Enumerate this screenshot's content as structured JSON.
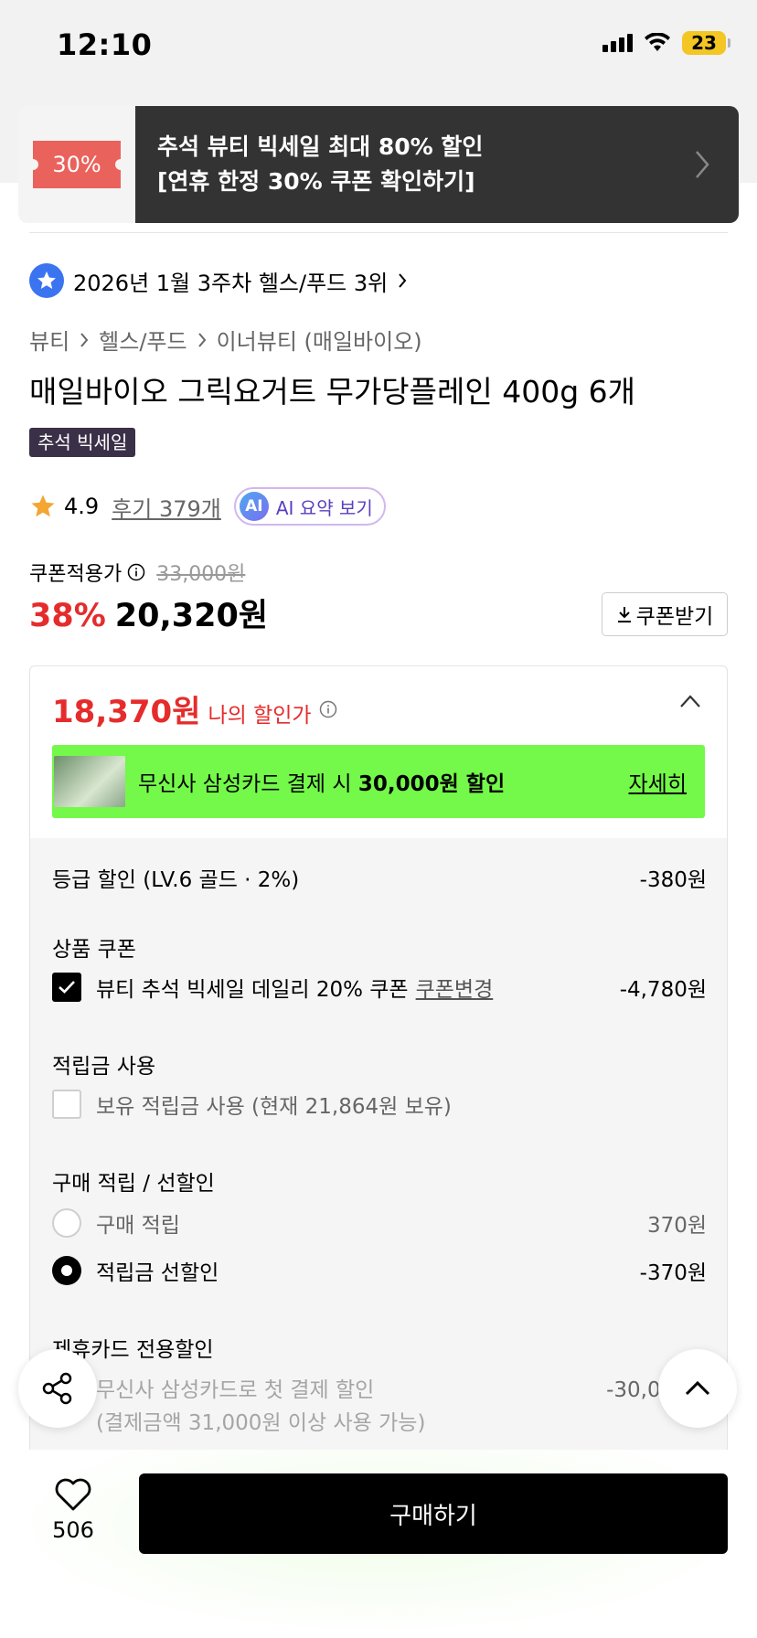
{
  "status_bar": {
    "time": "12:10",
    "battery": "23"
  },
  "banner": {
    "coupon_label": "30%",
    "line1": "추석 뷰티 빅세일 최대 80% 할인",
    "line2": "[연휴 한정 30% 쿠폰 확인하기]"
  },
  "ranking": {
    "text": "2026년 1월 3주차 헬스/푸드 3위"
  },
  "breadcrumb": [
    "뷰티",
    "헬스/푸드",
    "이너뷰티 (매일바이오)"
  ],
  "product": {
    "title": "매일바이오 그릭요거트 무가당플레인 400g 6개",
    "event_badge": "추석 빅세일",
    "rating": "4.9",
    "reviews": "후기 379개",
    "ai_summary": "AI 요약 보기",
    "ai_badge": "AI"
  },
  "pricing": {
    "coupon_price_label": "쿠폰적용가",
    "original_price": "33,000원",
    "discount_pct": "38%",
    "sale_price": "20,320원",
    "coupon_button": "쿠폰받기"
  },
  "my_price": {
    "amount": "18,370원",
    "label": "나의 할인가",
    "promo_text_1": "무신사 삼성카드 결제 시 ",
    "promo_text_bold": "30,000원 할인",
    "promo_link": "자세히"
  },
  "discounts": {
    "grade_label": "등급 할인 (LV.6 골드 · 2%)",
    "grade_amount": "-380원",
    "coupon_section": "상품 쿠폰",
    "coupon_item": "뷰티 추석 빅세일 데일리 20% 쿠폰",
    "coupon_change": "쿠폰변경",
    "coupon_amount": "-4,780원",
    "points_section": "적립금 사용",
    "points_item": "보유 적립금 사용 (현재 21,864원 보유)",
    "purchase_section": "구매 적립 / 선할인",
    "purchase_earn": "구매 적립",
    "purchase_earn_amount": "370원",
    "purchase_pre": "적립금 선할인",
    "purchase_pre_amount": "-370원",
    "card_section": "제휴카드 전용할인",
    "card_item": "무신사 삼성카드로 첫 결제 할인",
    "card_amount": "-30,000원",
    "card_note": "(결제금액 31,000원 이상 사용 가능)"
  },
  "bottom": {
    "likes": "506",
    "buy_button": "구매하기"
  },
  "colors": {
    "accent_red": "#e52c2c",
    "promo_green": "#74f84a",
    "banner_dark": "#333333",
    "coupon_tag": "#e9635c"
  }
}
